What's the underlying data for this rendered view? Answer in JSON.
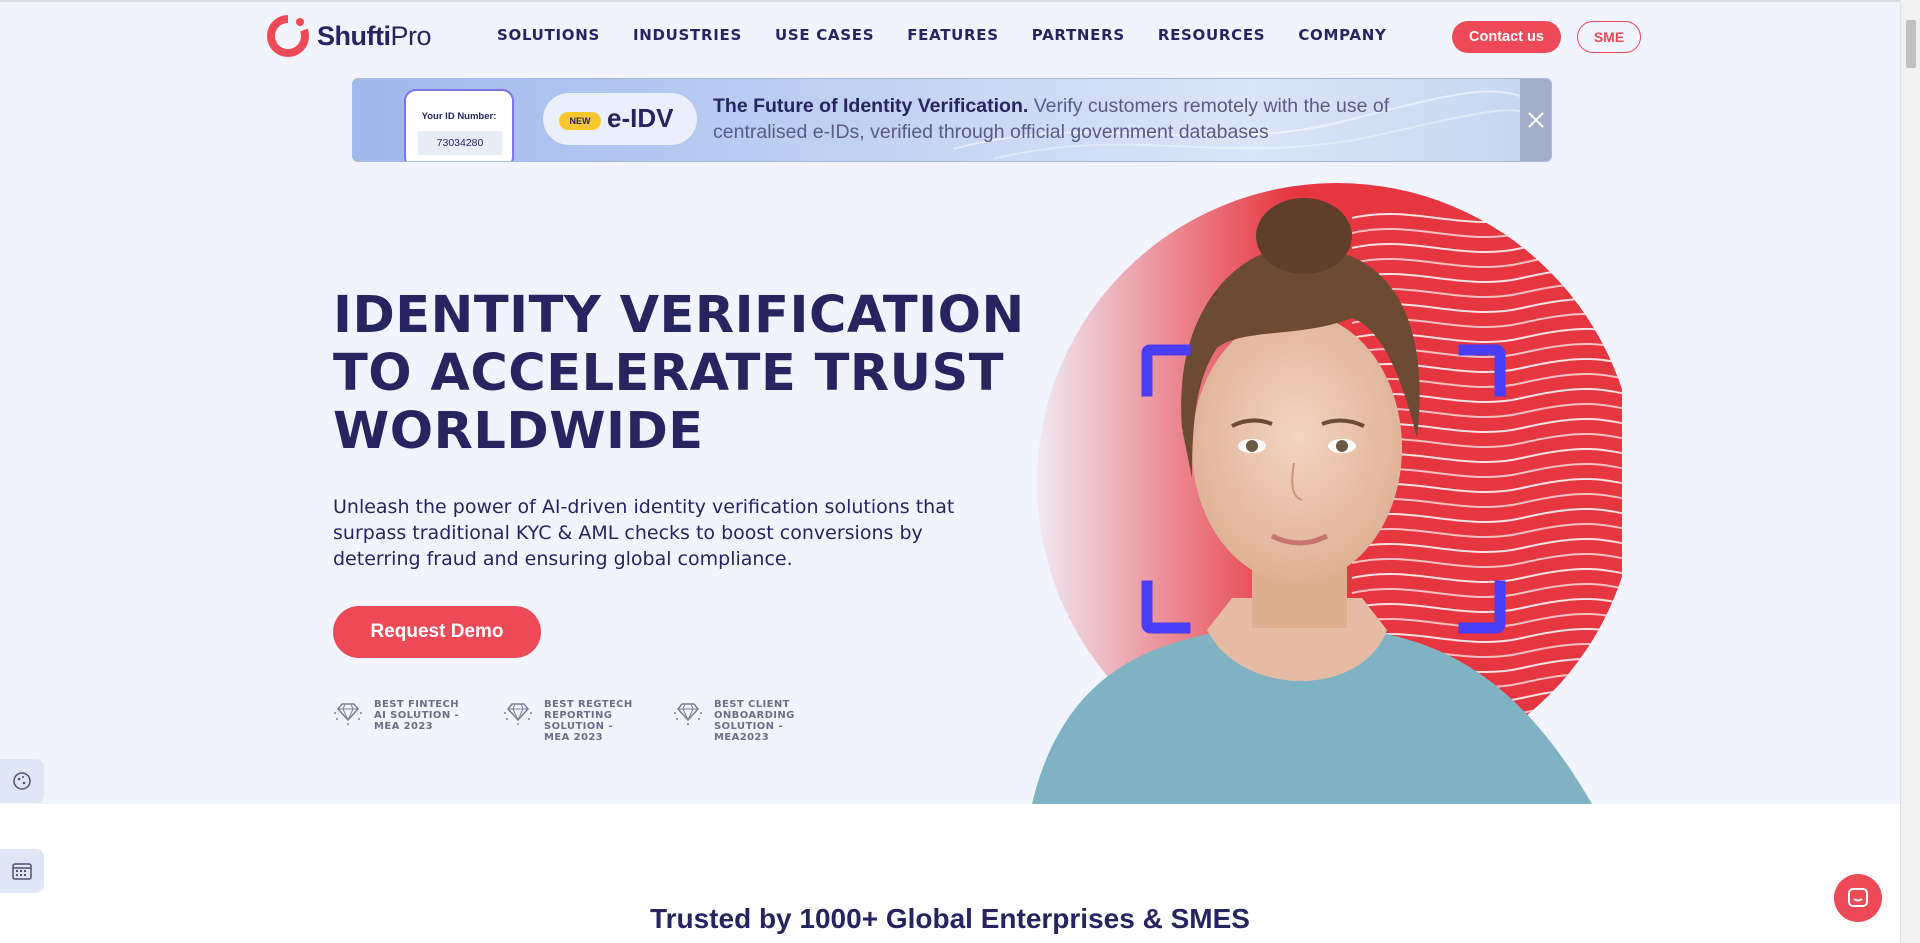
{
  "brand": {
    "name_bold": "Shufti",
    "name_light": "Pro",
    "accent": "#ee4956",
    "navy": "#262560",
    "frame_color": "#4b3cf5"
  },
  "nav": {
    "items": [
      "SOLUTIONS",
      "INDUSTRIES",
      "USE CASES",
      "FEATURES",
      "PARTNERS",
      "RESOURCES",
      "COMPANY"
    ]
  },
  "header": {
    "contact_label": "Contact us",
    "sme_label": "SME"
  },
  "banner": {
    "id_label": "Your ID Number:",
    "id_number": "73034280",
    "badge": "NEW",
    "product": "e-IDV",
    "headline": "The Future of Identity Verification.",
    "text": "Verify customers remotely with the use of centralised e-IDs, verified through official government databases",
    "close_icon": "close-icon"
  },
  "hero": {
    "title_lines": [
      "IDENTITY VERIFICATION",
      "TO ACCELERATE TRUST",
      "WORLDWIDE"
    ],
    "subtitle": "Unleash the power of AI-driven identity verification solutions that surpass traditional KYC & AML checks to boost conversions by deterring fraud and ensuring global compliance.",
    "cta_label": "Request Demo",
    "awards": [
      {
        "icon": "diamond-award-icon",
        "lines": [
          "BEST FINTECH",
          "AI SOLUTION -",
          "MEA 2023"
        ]
      },
      {
        "icon": "diamond-award-icon",
        "lines": [
          "BEST REGTECH",
          "REPORTING",
          "SOLUTION -",
          "MEA 2023"
        ]
      },
      {
        "icon": "diamond-award-icon",
        "lines": [
          "BEST CLIENT",
          "ONBOARDING",
          "SOLUTION -",
          "MEA2023"
        ]
      }
    ]
  },
  "trusted": {
    "heading": "Trusted by 1000+ Global Enterprises & SMES"
  },
  "widgets": {
    "cookie_icon": "cookie-icon",
    "calendar_icon": "calendar-icon",
    "chat_icon": "chat-icon"
  }
}
